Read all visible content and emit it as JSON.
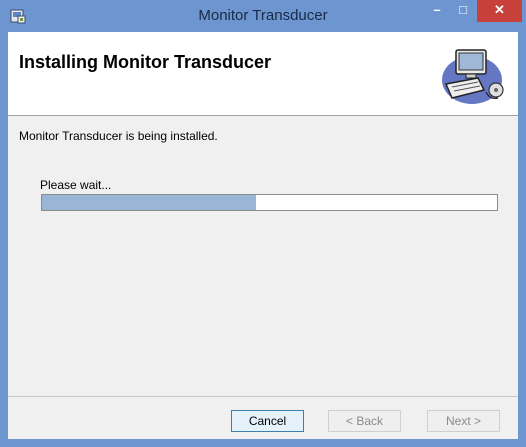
{
  "window": {
    "title": "Monitor Transducer",
    "minimize_glyph": "–",
    "maximize_glyph": "□",
    "close_glyph": "✕"
  },
  "banner": {
    "title": "Installing Monitor Transducer",
    "image_icon": "computer-installer-icon"
  },
  "body": {
    "status_text": "Monitor Transducer is being installed.",
    "wait_label": "Please wait...",
    "progress": 0.47
  },
  "buttons": {
    "cancel": "Cancel",
    "back": "< Back",
    "next": "Next >"
  },
  "colors": {
    "titlebar": "#6d96d1",
    "close_button": "#c7403a",
    "progress_fill": "#9ab6d7"
  }
}
